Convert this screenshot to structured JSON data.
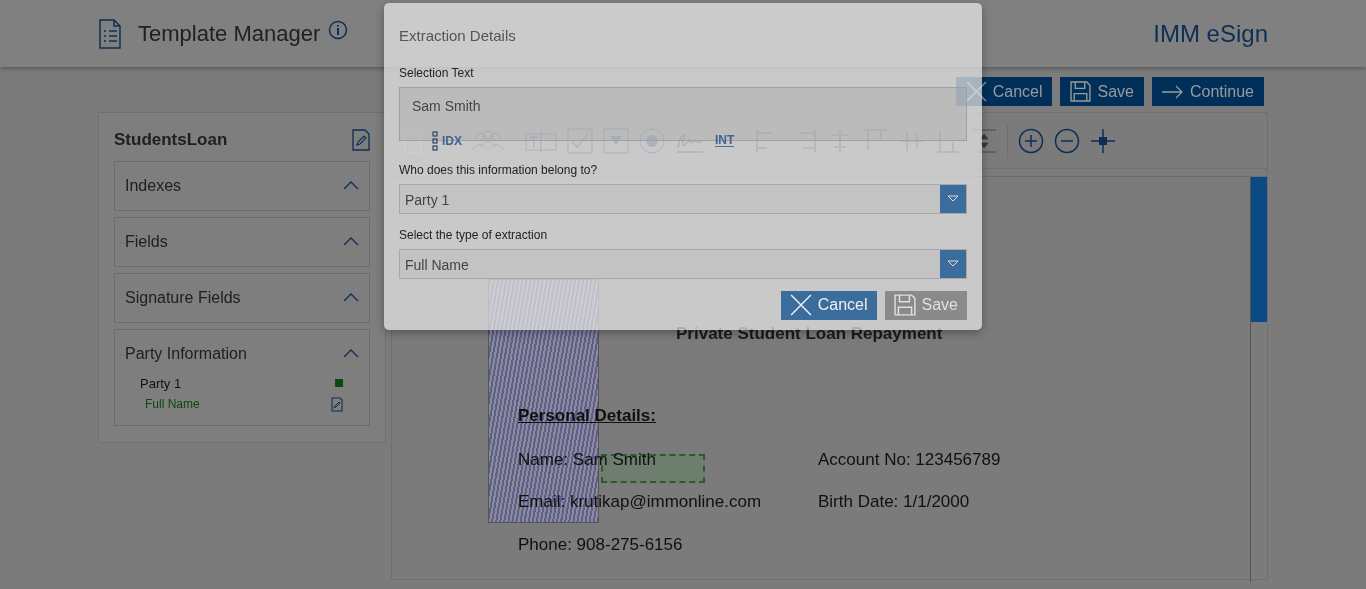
{
  "header": {
    "title": "Template Manager",
    "brand": "IMM eSign"
  },
  "actions": [
    {
      "label": "Cancel",
      "kind": "cancel"
    },
    {
      "label": "Save",
      "kind": "save"
    },
    {
      "label": "Continue",
      "kind": "continue"
    }
  ],
  "sidebar": {
    "title": "StudentsLoan",
    "sections": [
      {
        "label": "Indexes"
      },
      {
        "label": "Fields"
      },
      {
        "label": "Signature Fields"
      },
      {
        "label": "Party Information",
        "items": [
          {
            "label": "Party 1",
            "color": "#0a4a0a",
            "children": [
              {
                "label": "Full Name"
              }
            ]
          }
        ]
      }
    ]
  },
  "toolbar": {
    "labels": [
      "IDX",
      "INT"
    ]
  },
  "document": {
    "title": "Private Student Loan Repayment",
    "section": "Personal Details:",
    "fields": [
      {
        "label": "Name:",
        "value": "Sam Smith"
      },
      {
        "label": "Account No:",
        "value": "123456789"
      },
      {
        "label": "Email:",
        "value": "krutikap@immonline.com"
      },
      {
        "label": "Birth Date:",
        "value": "1/1/2000"
      },
      {
        "label": "Phone:",
        "value": "908-275-6156"
      }
    ]
  },
  "modal": {
    "title": "Extraction Details",
    "selection_label": "Selection Text",
    "selection_value": "Sam Smith",
    "party_label": "Who does this information belong to?",
    "party_value": "Party 1",
    "type_label": "Select the type of extraction",
    "type_value": "Full Name",
    "buttons": [
      {
        "label": "Cancel",
        "kind": "cancel",
        "disabled": false
      },
      {
        "label": "Save",
        "kind": "save",
        "disabled": true
      }
    ]
  }
}
